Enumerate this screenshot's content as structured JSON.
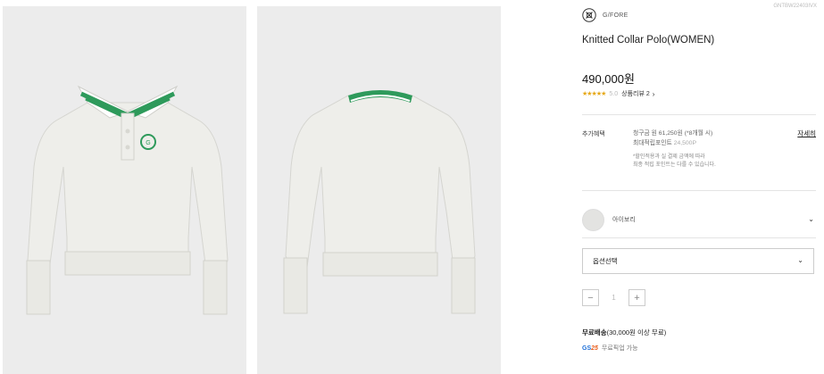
{
  "product": {
    "sku": "GNTBW22403IVX",
    "brand": "G/FORE",
    "title": "Knitted Collar Polo(WOMEN)",
    "price": "490,000원",
    "rating_stars": "★★★★★",
    "rating_score": "5.0",
    "review_link": "상품리뷰 2",
    "review_chevron": "›"
  },
  "benefits": {
    "label": "추가혜택",
    "line1": "청구금 원 61,250원 (*8개월 시)",
    "line2_label": "최대적립포인트",
    "line2_value": "24,500P",
    "note_line1": "*할인적용과 실 결제 금액에 따라",
    "note_line2": "최종 적립 포인트는 다를 수 있습니다.",
    "detail_link": "자세히"
  },
  "color": {
    "name": "아이보리",
    "swatch_color": "#e3e3e1",
    "chevron": "⌄"
  },
  "option": {
    "label": "옵션선택",
    "chevron": "⌄"
  },
  "quantity": {
    "minus": "−",
    "value": "1",
    "plus": "+"
  },
  "shipping": {
    "strong": "무료배송",
    "detail": "(30,000원 이상 무료)"
  },
  "gs25": {
    "logo_gs": "GS",
    "logo_num": "25",
    "text": "무료픽업 가능"
  },
  "icons": [
    "brand-logo-icon",
    "chevron-right-icon",
    "chevron-down-icon",
    "minus-icon",
    "plus-icon"
  ]
}
